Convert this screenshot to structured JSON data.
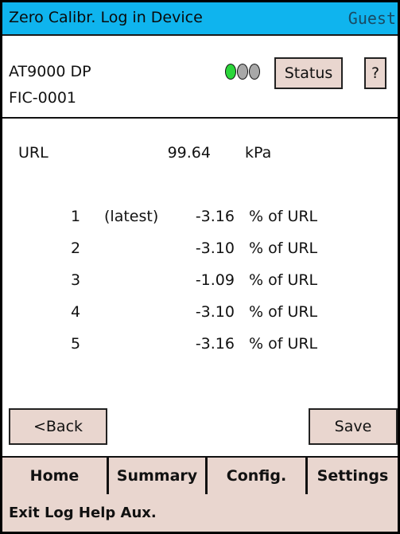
{
  "titlebar": {
    "title": "Zero Calibr. Log in Device",
    "user": "Guest"
  },
  "device": {
    "model": "AT9000 DP",
    "tag": "FIC-0001",
    "status_label": "Status",
    "help_label": "?"
  },
  "url": {
    "label": "URL",
    "value": "99.64",
    "unit": "kPa"
  },
  "log": [
    {
      "index": "1",
      "note": "(latest)",
      "value": "-3.16",
      "unit": "% of URL"
    },
    {
      "index": "2",
      "note": "",
      "value": "-3.10",
      "unit": "% of URL"
    },
    {
      "index": "3",
      "note": "",
      "value": "-1.09",
      "unit": "% of URL"
    },
    {
      "index": "4",
      "note": "",
      "value": "-3.10",
      "unit": "% of URL"
    },
    {
      "index": "5",
      "note": "",
      "value": "-3.16",
      "unit": "% of URL"
    }
  ],
  "actions": {
    "back_label": "<Back",
    "save_label": "Save"
  },
  "tabs": [
    "Home",
    "Summary",
    "Config.",
    "Settings"
  ],
  "footer": {
    "menu": "Exit  Log  Help  Aux."
  },
  "indicator": {
    "icon": "traffic-light-icon",
    "lit": "green"
  }
}
